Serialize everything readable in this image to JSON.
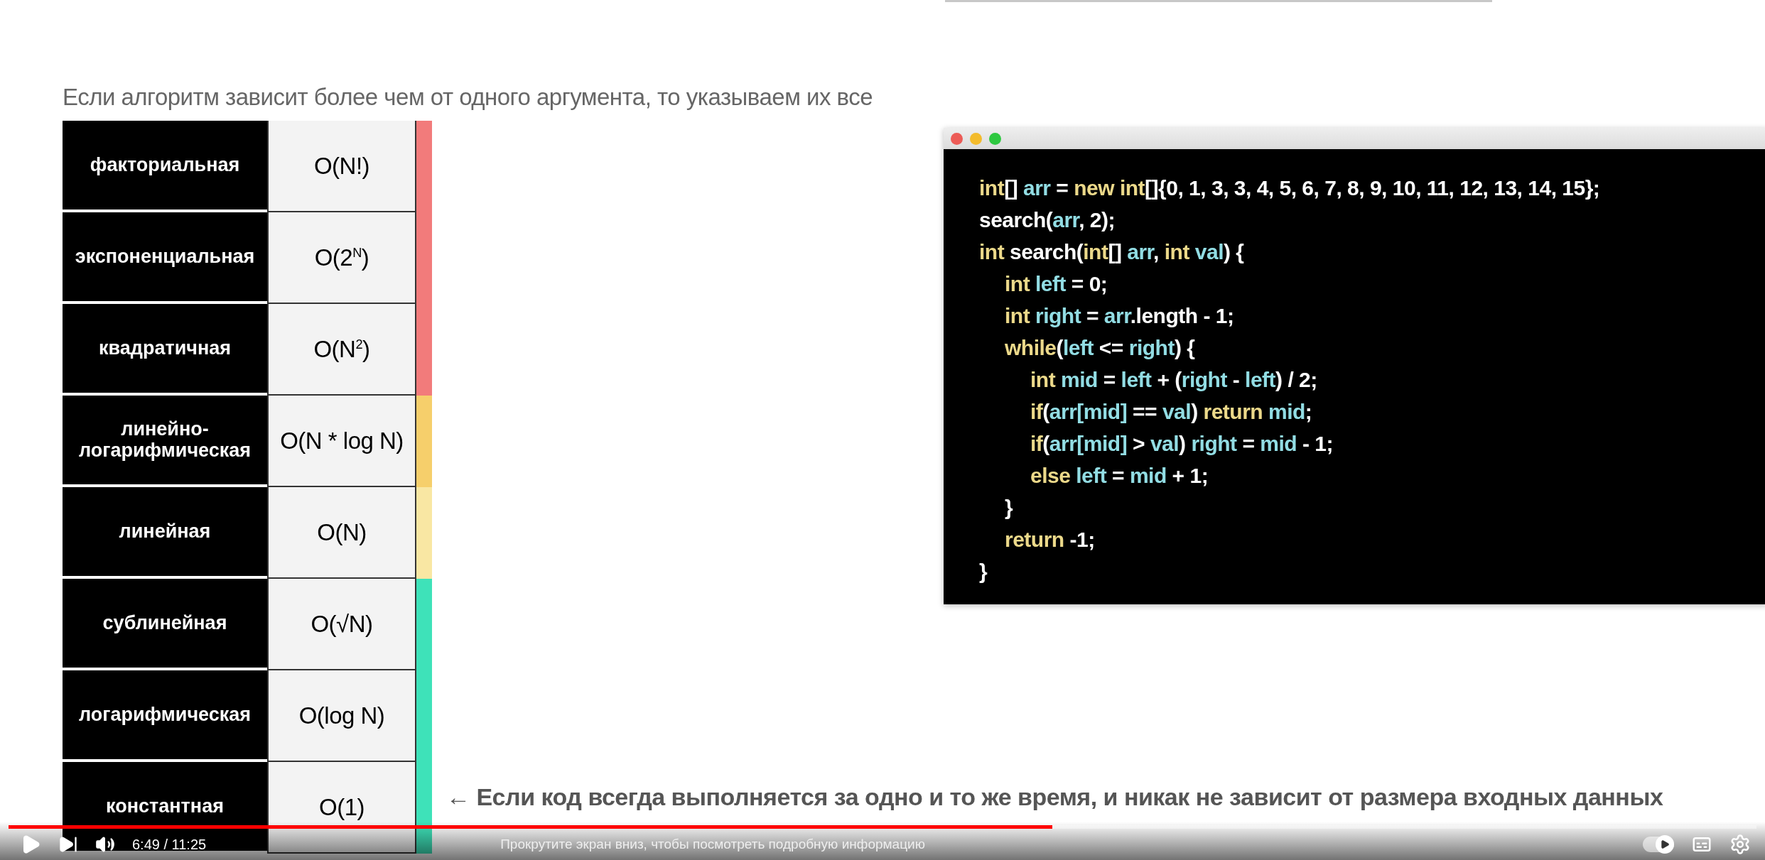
{
  "slide": {
    "heading": "Если алгоритм зависит более чем от одного аргумента, то указываем их все",
    "complexity_table": {
      "rows": [
        {
          "name": "факториальная",
          "notation": "O(N!)",
          "color": "#f27b7b"
        },
        {
          "name": "экспоненциальная",
          "notation": "O(2$^{N}$)",
          "color": "#f27b7b"
        },
        {
          "name": "квадратичная",
          "notation": "O(N$^{2}$)",
          "color": "#f27b7b"
        },
        {
          "name": "линейно-логарифмическая",
          "notation": "O(N * log N)",
          "color": "#f6cf6b"
        },
        {
          "name": "линейная",
          "notation": "O(N)",
          "color": "#f9e7a3"
        },
        {
          "name": "сублинейная",
          "notation": "O(√N)",
          "color": "#3ee2b9"
        },
        {
          "name": "логарифмическая",
          "notation": "O(log N)",
          "color": "#3ee2b9"
        },
        {
          "name": "константная",
          "notation": "O(1)",
          "color": "#3ee2b9",
          "note": "← Если код всегда выполняется за одно и то же время, и никак не зависит от размера входных данных"
        }
      ]
    },
    "code_window": {
      "lines": [
        {
          "tokens": [
            {
              "kind": "keyword",
              "text": "int"
            },
            {
              "kind": "plain",
              "text": "[] "
            },
            {
              "kind": "identifier",
              "text": "arr"
            },
            {
              "kind": "plain",
              "text": " = "
            },
            {
              "kind": "keyword",
              "text": "new int"
            },
            {
              "kind": "plain",
              "text": "[]{0, 1, 3, 3, 4, 5, 6, 7, 8, 9, 10, 11, 12, 13, 14, 15};"
            }
          ]
        },
        {
          "tokens": [
            {
              "kind": "plain",
              "text": "search("
            },
            {
              "kind": "identifier",
              "text": "arr"
            },
            {
              "kind": "plain",
              "text": ", 2);"
            }
          ]
        },
        {
          "tokens": [
            {
              "kind": "keyword",
              "text": "int"
            },
            {
              "kind": "plain",
              "text": " search("
            },
            {
              "kind": "keyword",
              "text": "int"
            },
            {
              "kind": "plain",
              "text": "[] "
            },
            {
              "kind": "identifier",
              "text": "arr"
            },
            {
              "kind": "plain",
              "text": ", "
            },
            {
              "kind": "keyword",
              "text": "int "
            },
            {
              "kind": "identifier",
              "text": "val"
            },
            {
              "kind": "plain",
              "text": ") {"
            }
          ],
          "children": [
            {
              "tokens": [
                {
                  "kind": "keyword",
                  "text": "int "
                },
                {
                  "kind": "identifier",
                  "text": "left"
                },
                {
                  "kind": "plain",
                  "text": " = 0;"
                }
              ]
            },
            {
              "tokens": [
                {
                  "kind": "keyword",
                  "text": "int "
                },
                {
                  "kind": "identifier",
                  "text": "right"
                },
                {
                  "kind": "plain",
                  "text": " = "
                },
                {
                  "kind": "identifier",
                  "text": "arr"
                },
                {
                  "kind": "plain",
                  "text": ".length - 1;"
                }
              ]
            },
            {
              "tokens": [
                {
                  "kind": "keyword",
                  "text": "while"
                },
                {
                  "kind": "plain",
                  "text": "("
                },
                {
                  "kind": "identifier",
                  "text": "left"
                },
                {
                  "kind": "plain",
                  "text": " <= "
                },
                {
                  "kind": "identifier",
                  "text": "right"
                },
                {
                  "kind": "plain",
                  "text": ") {"
                }
              ],
              "children": [
                {
                  "tokens": [
                    {
                      "kind": "keyword",
                      "text": "int "
                    },
                    {
                      "kind": "identifier",
                      "text": "mid"
                    },
                    {
                      "kind": "plain",
                      "text": " = "
                    },
                    {
                      "kind": "identifier",
                      "text": "left"
                    },
                    {
                      "kind": "plain",
                      "text": " + ("
                    },
                    {
                      "kind": "identifier",
                      "text": "right"
                    },
                    {
                      "kind": "plain",
                      "text": " - "
                    },
                    {
                      "kind": "identifier",
                      "text": "left"
                    },
                    {
                      "kind": "plain",
                      "text": ") / 2;"
                    }
                  ]
                },
                {
                  "tokens": [
                    {
                      "kind": "keyword",
                      "text": "if"
                    },
                    {
                      "kind": "plain",
                      "text": "("
                    },
                    {
                      "kind": "identifier",
                      "text": "arr[mid]"
                    },
                    {
                      "kind": "plain",
                      "text": " == "
                    },
                    {
                      "kind": "identifier",
                      "text": "val"
                    },
                    {
                      "kind": "plain",
                      "text": ") "
                    },
                    {
                      "kind": "keyword",
                      "text": "return "
                    },
                    {
                      "kind": "identifier",
                      "text": "mid"
                    },
                    {
                      "kind": "plain",
                      "text": ";"
                    }
                  ]
                },
                {
                  "tokens": [
                    {
                      "kind": "keyword",
                      "text": "if"
                    },
                    {
                      "kind": "plain",
                      "text": "("
                    },
                    {
                      "kind": "identifier",
                      "text": "arr[mid]"
                    },
                    {
                      "kind": "plain",
                      "text": " > "
                    },
                    {
                      "kind": "identifier",
                      "text": "val"
                    },
                    {
                      "kind": "plain",
                      "text": ") "
                    },
                    {
                      "kind": "identifier",
                      "text": "right"
                    },
                    {
                      "kind": "plain",
                      "text": " = "
                    },
                    {
                      "kind": "identifier",
                      "text": "mid"
                    },
                    {
                      "kind": "plain",
                      "text": " - 1;"
                    }
                  ]
                },
                {
                  "tokens": [
                    {
                      "kind": "keyword",
                      "text": "else "
                    },
                    {
                      "kind": "identifier",
                      "text": "left"
                    },
                    {
                      "kind": "plain",
                      "text": " = "
                    },
                    {
                      "kind": "identifier",
                      "text": "mid"
                    },
                    {
                      "kind": "plain",
                      "text": " + 1;"
                    }
                  ]
                }
              ]
            },
            {
              "tokens": [
                {
                  "kind": "plain",
                  "text": "}"
                }
              ]
            },
            {
              "tokens": [
                {
                  "kind": "keyword",
                  "text": "return"
                },
                {
                  "kind": "plain",
                  "text": " -1;"
                }
              ]
            }
          ]
        },
        {
          "tokens": [
            {
              "kind": "plain",
              "text": "}"
            }
          ]
        }
      ]
    }
  },
  "player": {
    "playing": false,
    "progress": {
      "level": 0.597
    },
    "time": "6:49 / 11:25",
    "hint": "Прокрутите экран вниз, чтобы посмотреть подробную информацию",
    "autoplay": {
      "on": true
    }
  }
}
